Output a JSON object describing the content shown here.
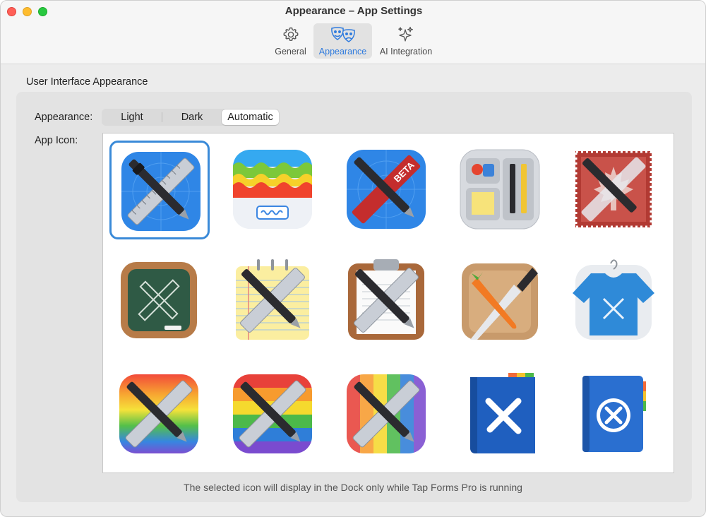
{
  "window": {
    "title": "Appearance – App Settings"
  },
  "toolbar": {
    "tabs": [
      {
        "label": "General",
        "icon": "gear-icon",
        "active": false
      },
      {
        "label": "Appearance",
        "icon": "theater-masks-icon",
        "active": true
      },
      {
        "label": "AI Integration",
        "icon": "sparkles-icon",
        "active": false
      }
    ]
  },
  "section": {
    "title": "User Interface Appearance"
  },
  "appearance": {
    "label": "Appearance:",
    "options": [
      "Light",
      "Dark",
      "Automatic"
    ],
    "selected": "Automatic"
  },
  "app_icon": {
    "label": "App Icon:",
    "selected_index": 0,
    "icons": [
      {
        "name": "classic-blue-icon"
      },
      {
        "name": "rainbow-scallop-icon"
      },
      {
        "name": "beta-blue-icon",
        "badge": "BETA"
      },
      {
        "name": "desk-organizer-icon"
      },
      {
        "name": "canada-stamp-icon"
      },
      {
        "name": "chalkboard-icon"
      },
      {
        "name": "notepad-icon"
      },
      {
        "name": "clipboard-icon"
      },
      {
        "name": "cutting-board-icon"
      },
      {
        "name": "tshirt-icon"
      },
      {
        "name": "rainbow-vertical-icon"
      },
      {
        "name": "rainbow-horizontal-icon"
      },
      {
        "name": "rainbow-stripes-icon"
      },
      {
        "name": "blue-folder-icon"
      },
      {
        "name": "blue-book-icon"
      }
    ]
  },
  "footer": {
    "note": "The selected icon will display in the Dock only while Tap Forms Pro is running"
  },
  "colors": {
    "accent": "#3a8ad8",
    "selected_tab_text": "#2f7bde"
  }
}
